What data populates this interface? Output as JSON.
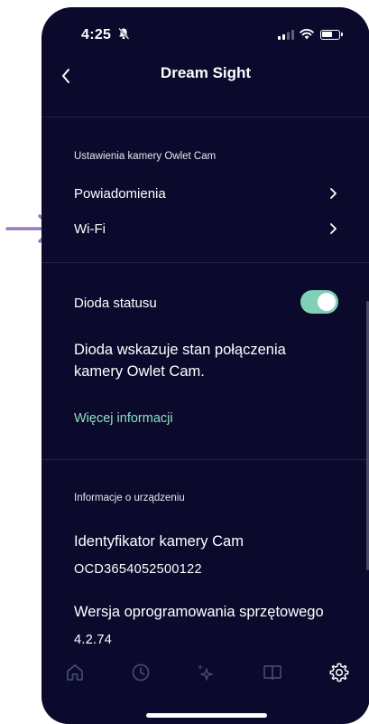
{
  "status_bar": {
    "time": "4:25"
  },
  "nav": {
    "title": "Dream Sight"
  },
  "camera_settings": {
    "section_label": "Ustawienia kamery Owlet Cam",
    "items": [
      {
        "label": "Powiadomienia"
      },
      {
        "label": "Wi-Fi"
      }
    ]
  },
  "status_led": {
    "label": "Dioda statusu",
    "enabled": true,
    "description": "Dioda wskazuje stan połączenia kamery Owlet Cam.",
    "more_link": "Więcej informacji"
  },
  "device_info": {
    "section_label": "Informacje o urządzeniu",
    "camera_id_label": "Identyfikator kamery Cam",
    "camera_id_value": "OCD3654052500122",
    "firmware_label": "Wersja oprogramowania sprzętowego",
    "firmware_value": "4.2.74"
  },
  "tabbar": {
    "tabs": [
      {
        "icon": "home-icon",
        "active": false
      },
      {
        "icon": "clock-icon",
        "active": false
      },
      {
        "icon": "sparkle-icon",
        "active": false
      },
      {
        "icon": "book-icon",
        "active": false
      },
      {
        "icon": "gear-icon",
        "active": true
      }
    ]
  },
  "colors": {
    "background": "#0b0a2c",
    "accent": "#8fe0c2",
    "toggle_on": "#7fd0b4",
    "annotation_arrow": "#9b7bb8"
  }
}
